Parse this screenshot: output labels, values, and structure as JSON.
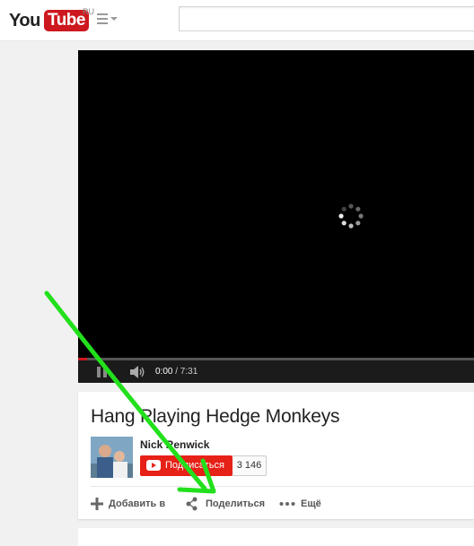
{
  "header": {
    "logo_you": "You",
    "logo_tube": "Tube",
    "logo_region": "RU",
    "search_placeholder": ""
  },
  "player": {
    "current_time": "0:00",
    "duration": "/ 7:31",
    "progress_fraction": 0.0,
    "state": "buffering"
  },
  "video": {
    "title": "Hang Playing Hedge Monkeys",
    "channel_name": "Nick Renwick",
    "subscribe_label": "Подписаться",
    "subscriber_count": "3 146"
  },
  "actions": {
    "add_to": "Добавить в",
    "share": "Поделиться",
    "more": "Ещё"
  },
  "colors": {
    "brand_red": "#cc181e",
    "subscribe_red": "#e62117",
    "annotation_arrow": "#22e01c"
  },
  "icons": [
    "guide-menu-icon",
    "play-icon",
    "volume-icon",
    "loading-spinner-icon",
    "plus-icon",
    "share-icon",
    "more-dots-icon",
    "youtube-play-icon"
  ]
}
